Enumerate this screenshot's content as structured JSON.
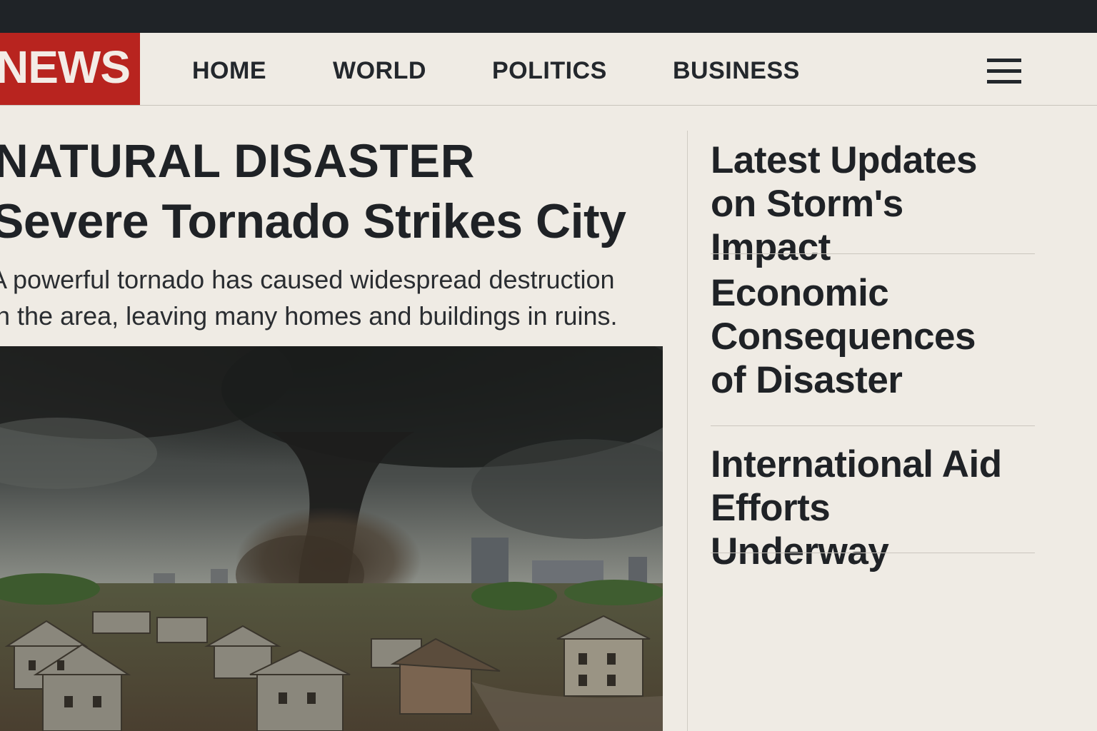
{
  "nav": {
    "logo": "NEWS",
    "links": [
      "HOME",
      "WORLD",
      "POLITICS",
      "BUSINESS"
    ],
    "menu_icon": "hamburger-menu-icon"
  },
  "article": {
    "kicker": "NATURAL DISASTER",
    "headline": "Severe Tornado Strikes City",
    "summary": "A powerful tornado has caused widespread destruction in the area, leaving many homes and buildings in ruins.",
    "image": "tornado over damaged neighborhood"
  },
  "sidebar": {
    "stories": [
      {
        "title": "Latest Updates on Storm's Impact"
      },
      {
        "title": "Economic Consequences of Disaster"
      },
      {
        "title": "International Aid Efforts Underway"
      }
    ]
  },
  "colors": {
    "brand_red": "#b8241f",
    "background": "#efebe4",
    "top_bar": "#1f2327",
    "text": "#1f2226"
  }
}
